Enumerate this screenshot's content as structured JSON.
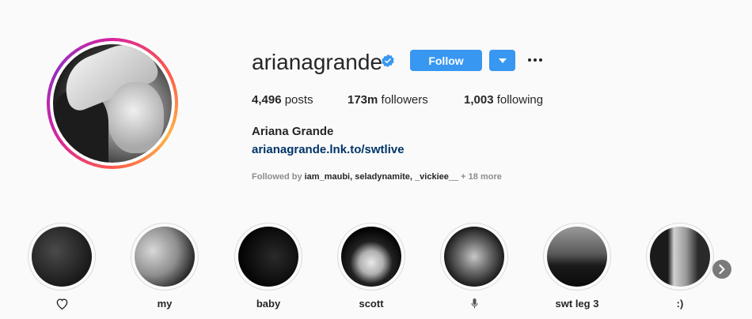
{
  "profile": {
    "username": "arianagrande",
    "verified_icon": "verified-badge-icon",
    "follow_label": "Follow",
    "dropdown_icon": "caret-down-icon",
    "more_icon": "more-options-icon",
    "stats": {
      "posts_count": "4,496",
      "posts_label": "posts",
      "followers_count": "173m",
      "followers_label": "followers",
      "following_count": "1,003",
      "following_label": "following"
    },
    "full_name": "Ariana Grande",
    "link": "arianagrande.lnk.to/swtlive",
    "followed_by_prefix": "Followed by",
    "followed_by": [
      "iam_maubi",
      "seladynamite",
      "_vickiee__"
    ],
    "followed_by_more": "+ 18 more"
  },
  "highlights": [
    {
      "label": "♡",
      "icon": "heart-icon"
    },
    {
      "label": "my"
    },
    {
      "label": "baby"
    },
    {
      "label": "scott"
    },
    {
      "label": "🎙",
      "icon": "microphone-icon"
    },
    {
      "label": "swt leg 3"
    },
    {
      "label": ":)"
    }
  ],
  "colors": {
    "accent": "#3897f0",
    "link": "#003569",
    "muted": "#8e8e8e",
    "background": "#fafafa"
  }
}
